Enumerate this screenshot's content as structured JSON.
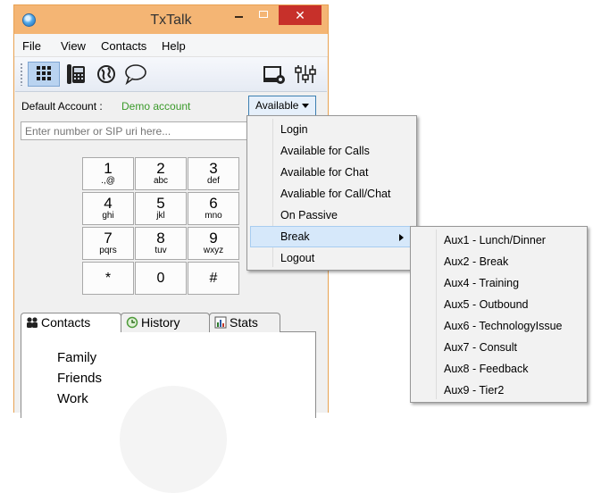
{
  "window": {
    "title": "TxTalk",
    "close_glyph": "✕",
    "menu": [
      "File",
      "View",
      "Contacts",
      "Help"
    ]
  },
  "toolbar": {
    "left_icons": [
      "dialpad-icon",
      "phone-icon",
      "globe-icon",
      "chat-icon"
    ],
    "right_icons": [
      "settings-monitor-icon",
      "audio-mixer-icon"
    ]
  },
  "account": {
    "label": "Default Account :",
    "value": "Demo account",
    "status": "Available"
  },
  "dial": {
    "placeholder": "Enter number or SIP uri here...",
    "keys": [
      {
        "d": "1",
        "l": ".,@"
      },
      {
        "d": "2",
        "l": "abc"
      },
      {
        "d": "3",
        "l": "def"
      },
      {
        "d": "4",
        "l": "ghi"
      },
      {
        "d": "5",
        "l": "jkl"
      },
      {
        "d": "6",
        "l": "mno"
      },
      {
        "d": "7",
        "l": "pqrs"
      },
      {
        "d": "8",
        "l": "tuv"
      },
      {
        "d": "9",
        "l": "wxyz"
      },
      {
        "d": "*",
        "l": ""
      },
      {
        "d": "0",
        "l": ""
      },
      {
        "d": "#",
        "l": ""
      }
    ]
  },
  "tabs": [
    "Contacts",
    "History",
    "Stats"
  ],
  "contact_groups": [
    "Family",
    "Friends",
    "Work"
  ],
  "status_menu": [
    "Login",
    "Available for Calls",
    "Available for Chat",
    "Avaliable for Call/Chat",
    "On Passive",
    "Break",
    "Logout"
  ],
  "break_menu": [
    "Aux1 - Lunch/Dinner",
    "Aux2 - Break",
    "Aux4 - Training",
    "Aux5 - Outbound",
    "Aux6 - TechnologyIssue",
    "Aux7 - Consult",
    "Aux8 - Feedback",
    "Aux9 - Tier2"
  ],
  "colors": {
    "titlebar": "#f4b574",
    "close": "#c7302a",
    "account_value": "#3a9a2a",
    "menu_highlight": "#d6e8fa"
  }
}
